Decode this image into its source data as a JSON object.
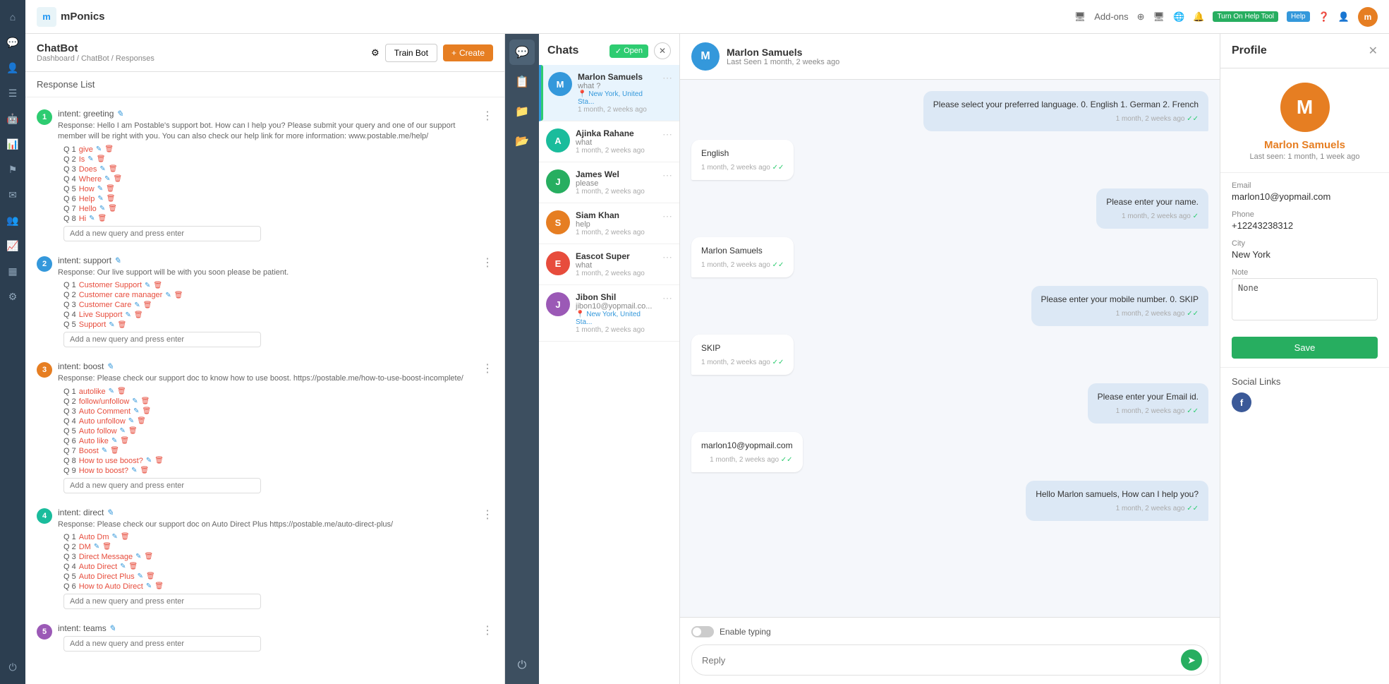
{
  "app": {
    "logo_text": "mPonics",
    "logo_letter": "m"
  },
  "header": {
    "addons": "Add-ons",
    "turn_on_label": "Turn On Help Tool",
    "help_label": "Help",
    "user_badge": "m"
  },
  "chatbot": {
    "title": "ChatBot",
    "breadcrumb": "Dashboard / ChatBot / Responses",
    "train_btn": "Train Bot",
    "create_btn": "Create",
    "response_list_title": "Response List",
    "intents": [
      {
        "num": "1",
        "color": "green",
        "name": "intent: greeting",
        "response": "Response: Hello I am Postable's support bot. How can I help you? Please submit your query and one of our support member will be right with you. You can also check our help link for more information: www.postable.me/help/",
        "queries": [
          "give",
          "Is",
          "Does",
          "Where",
          "How",
          "Help",
          "Hello",
          "Hi"
        ],
        "placeholder": "Add a new query and press enter"
      },
      {
        "num": "2",
        "color": "blue",
        "name": "intent: support",
        "response": "Response: Our live support will be with you soon please be patient.",
        "queries": [
          "Customer Support",
          "Customer care manager",
          "Customer Care",
          "Live Support",
          "Support"
        ],
        "placeholder": "Add a new query and press enter"
      },
      {
        "num": "3",
        "color": "orange",
        "name": "intent: boost",
        "response": "Response: Please check our support doc to know how to use boost. https://postable.me/how-to-use-boost-incomplete/",
        "queries": [
          "autolike",
          "follow/unfollow",
          "Auto Comment",
          "Auto unfollow",
          "Auto follow",
          "Auto like",
          "Boost",
          "How to use boost?",
          "How to boost?"
        ],
        "placeholder": "Add a new query and press enter"
      },
      {
        "num": "4",
        "color": "teal",
        "name": "intent: direct",
        "response": "Response: Please check our support doc on Auto Direct Plus https://postable.me/auto-direct-plus/",
        "queries": [
          "Auto Dm",
          "DM",
          "Direct Message",
          "Auto Direct",
          "Auto Direct Plus",
          "How to Auto Direct"
        ],
        "placeholder": "Add a new query and press enter"
      },
      {
        "num": "5",
        "color": "purple",
        "name": "intent: teams",
        "response": "",
        "queries": [],
        "placeholder": "Add a new query and press enter"
      }
    ]
  },
  "icon_sidebar": {
    "icons": [
      "💬",
      "📋",
      "📁",
      "📂"
    ]
  },
  "chats": {
    "title": "Chats",
    "open_label": "Open",
    "items": [
      {
        "name": "Marlon Samuels",
        "avatar_letter": "M",
        "avatar_color": "#3498db",
        "message": "what ?",
        "location": "New York, United Sta...",
        "time": "1 month, 2 weeks ago",
        "active": true
      },
      {
        "name": "Ajinka Rahane",
        "avatar_letter": "A",
        "avatar_color": "#1abc9c",
        "message": "what",
        "location": "",
        "time": "1 month, 2 weeks ago",
        "active": false
      },
      {
        "name": "James Wel",
        "avatar_letter": "J",
        "avatar_color": "#27ae60",
        "message": "please",
        "location": "",
        "time": "1 month, 2 weeks ago",
        "active": false
      },
      {
        "name": "Siam Khan",
        "avatar_letter": "S",
        "avatar_color": "#e67e22",
        "message": "help",
        "location": "",
        "time": "1 month, 2 weeks ago",
        "active": false
      },
      {
        "name": "Eascot Super",
        "avatar_letter": "E",
        "avatar_color": "#e74c3c",
        "message": "what",
        "location": "",
        "time": "1 month, 2 weeks ago",
        "active": false
      },
      {
        "name": "Jibon Shil",
        "avatar_letter": "J",
        "avatar_color": "#9b59b6",
        "message": "jibon10@yopmail.co...",
        "location": "New York, United Sta...",
        "time": "1 month, 2 weeks ago",
        "active": false
      }
    ]
  },
  "conversation": {
    "user_name": "Marlon Samuels",
    "user_avatar": "M",
    "last_seen": "Last Seen 1 month, 2 weeks ago",
    "messages": [
      {
        "text": "Please select your preferred language. 0. English 1. German 2. French",
        "type": "incoming",
        "time": "1 month, 2 weeks ago",
        "checks": "✓✓"
      },
      {
        "text": "English",
        "type": "outgoing",
        "time": "1 month, 2 weeks ago",
        "checks": "✓✓"
      },
      {
        "text": "Please enter your name.",
        "type": "incoming",
        "time": "1 month, 2 weeks ago",
        "checks": "✓"
      },
      {
        "text": "Marlon Samuels",
        "type": "outgoing",
        "time": "1 month, 2 weeks ago",
        "checks": "✓✓"
      },
      {
        "text": "Please enter your mobile number. 0. SKIP",
        "type": "incoming",
        "time": "1 month, 2 weeks ago",
        "checks": "✓✓"
      },
      {
        "text": "SKIP",
        "type": "outgoing",
        "time": "1 month, 2 weeks ago",
        "checks": "✓✓"
      },
      {
        "text": "Please enter your Email id.",
        "type": "incoming",
        "time": "1 month, 2 weeks ago",
        "checks": "✓✓"
      },
      {
        "text": "marlon10@yopmail.com",
        "type": "outgoing",
        "time": "1 month, 2 weeks ago",
        "checks": "✓✓"
      },
      {
        "text": "Hello Marlon samuels, How can I help you?",
        "type": "incoming",
        "time": "1 month, 2 weeks ago",
        "checks": "✓✓"
      }
    ],
    "typing_label": "Enable typing",
    "reply_placeholder": "Reply"
  },
  "profile": {
    "title": "Profile",
    "user_name": "Marlon Samuels",
    "user_avatar": "M",
    "last_seen": "Last seen: 1 month, 1 week ago",
    "email_label": "Email",
    "email": "marlon10@yopmail.com",
    "phone_label": "Phone",
    "phone": "+12243238312",
    "city_label": "City",
    "city": "New York",
    "note_label": "Note",
    "note": "None",
    "save_btn": "Save",
    "social_title": "Social Links",
    "facebook_letter": "f"
  }
}
